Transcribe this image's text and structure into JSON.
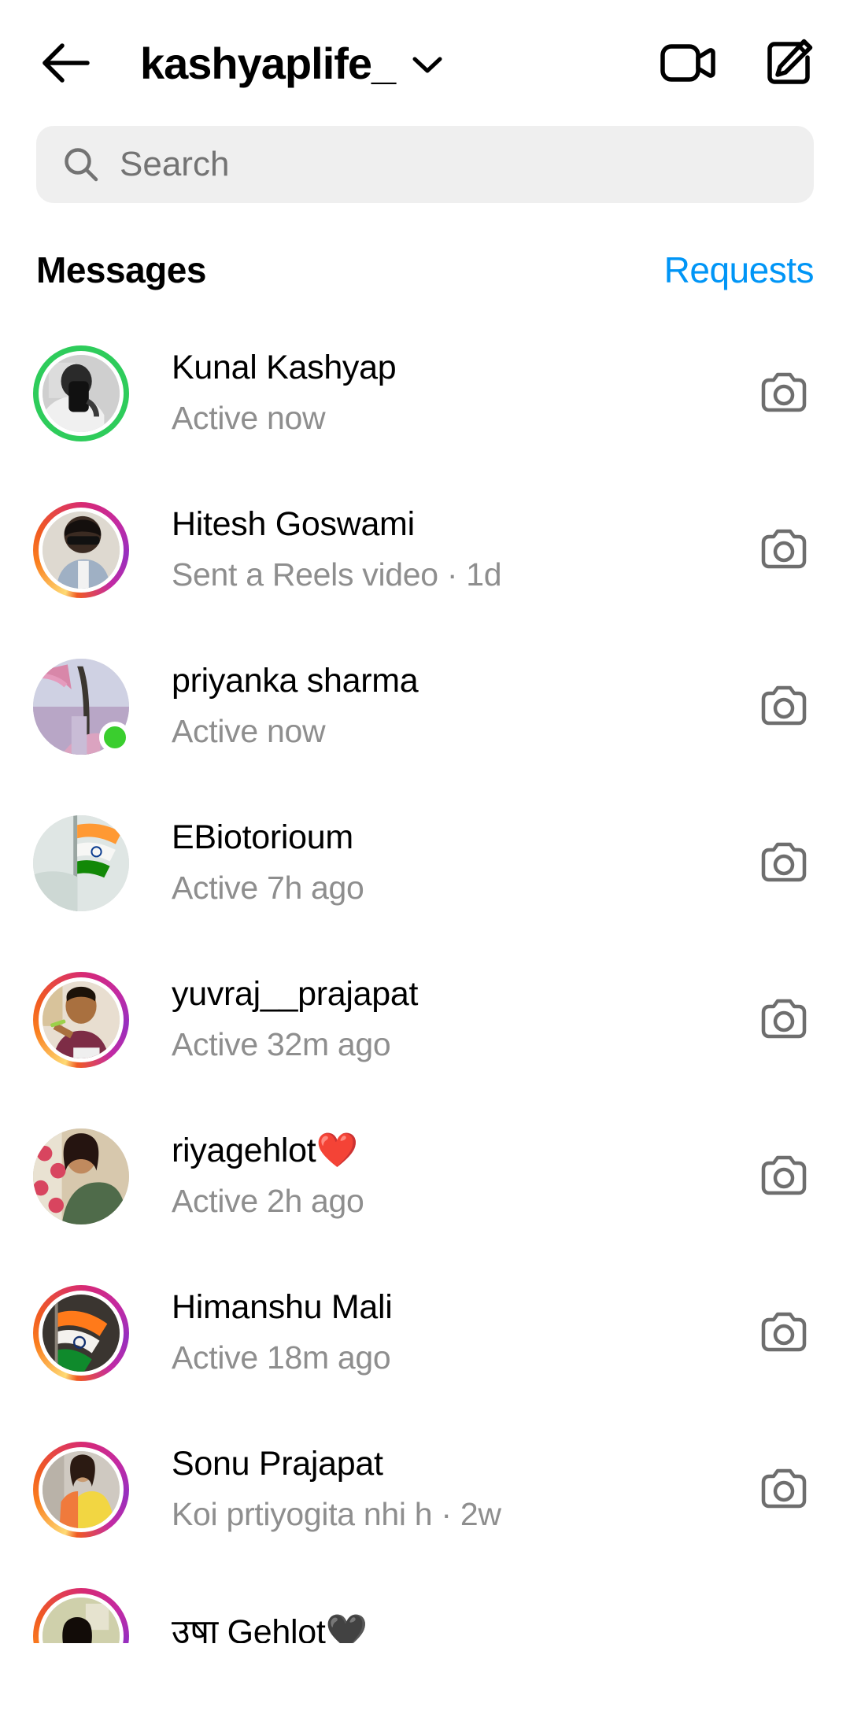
{
  "header": {
    "back_icon": "back-arrow-icon",
    "account_name": "kashyaplife_",
    "chevron_icon": "chevron-down-icon",
    "video_call_icon": "video-camera-icon",
    "new_message_icon": "compose-pencil-icon"
  },
  "search": {
    "icon": "search-icon",
    "placeholder": "Search",
    "value": ""
  },
  "section": {
    "title": "Messages",
    "action_label": "Requests",
    "action_color": "#0095F6"
  },
  "colors": {
    "accent_blue": "#0095F6",
    "online_green": "#3ACE2E",
    "close_friends_green": "#2ECC5B",
    "secondary_text": "#8e8e8e",
    "search_bg": "#efefef"
  },
  "conversations": [
    {
      "name": "Kunal Kashyap",
      "snippet": "Active now",
      "ring": "green",
      "online_dot": false,
      "avatar_style": "portrait-grayscale",
      "camera_icon": "camera-icon"
    },
    {
      "name": "Hitesh Goswami",
      "snippet": "Sent a Reels video · 1d",
      "ring": "gradient",
      "online_dot": false,
      "avatar_style": "portrait-sunglasses",
      "camera_icon": "camera-icon"
    },
    {
      "name": "priyanka sharma",
      "snippet": "Active now",
      "ring": "none",
      "online_dot": true,
      "avatar_style": "scenery-blossom-lake",
      "camera_icon": "camera-icon"
    },
    {
      "name": "EBiotorioum",
      "snippet": "Active 7h ago",
      "ring": "none",
      "online_dot": false,
      "avatar_style": "flag-india-sky",
      "camera_icon": "camera-icon"
    },
    {
      "name": "yuvraj__prajapat",
      "snippet": "Active 32m ago",
      "ring": "gradient",
      "online_dot": false,
      "avatar_style": "portrait-maroon-shirt",
      "camera_icon": "camera-icon"
    },
    {
      "name": "riyagehlot❤️",
      "snippet": "Active 2h ago",
      "ring": "none",
      "online_dot": false,
      "avatar_style": "portrait-green-dupatta",
      "camera_icon": "camera-icon"
    },
    {
      "name": "Himanshu Mali",
      "snippet": "Active 18m ago",
      "ring": "gradient",
      "online_dot": false,
      "avatar_style": "flag-india-dark",
      "camera_icon": "camera-icon"
    },
    {
      "name": "Sonu Prajapat",
      "snippet": "Koi prtiyogita nhi h · 2w",
      "ring": "gradient",
      "online_dot": false,
      "avatar_style": "portrait-yellow-dress",
      "camera_icon": "camera-icon"
    },
    {
      "name": "उषा Gehlot🖤",
      "snippet": "",
      "ring": "gradient",
      "online_dot": false,
      "avatar_style": "portrait-dark-hair",
      "camera_icon": "camera-icon",
      "clipped": true
    }
  ]
}
